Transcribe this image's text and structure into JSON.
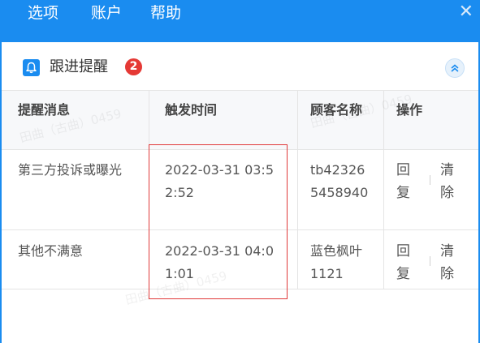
{
  "menu": {
    "items": [
      "选项",
      "账户",
      "帮助"
    ],
    "close": "✕"
  },
  "panel": {
    "icon": "bell-icon",
    "title": "跟进提醒",
    "badge": "2",
    "collapse_icon": "double-chevron-up-icon"
  },
  "table": {
    "columns": [
      "提醒消息",
      "触发时间",
      "顾客名称",
      "操作"
    ],
    "rows": [
      {
        "message": "第三方投诉或曝光",
        "time": "2022-03-31 03:52:52",
        "customer": "tb423265458940",
        "reply": "回复",
        "clear": "清除"
      },
      {
        "message": "其他不满意",
        "time": "2022-03-31 04:01:01",
        "customer": "蓝色枫叶1121",
        "reply": "回复",
        "clear": "清除"
      }
    ]
  },
  "watermark": "田曲（古曲）0459",
  "colors": {
    "accent": "#1a8cf0",
    "badge": "#e53935",
    "highlight": "#e03a3a"
  }
}
